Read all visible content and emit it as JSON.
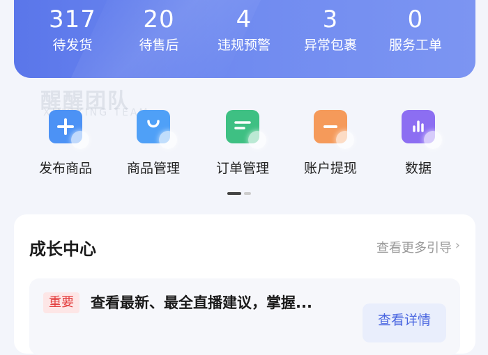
{
  "stats": [
    {
      "value": "317",
      "label": "待发货"
    },
    {
      "value": "20",
      "label": "待售后"
    },
    {
      "value": "4",
      "label": "违规预警"
    },
    {
      "value": "3",
      "label": "异常包裹"
    },
    {
      "value": "0",
      "label": "服务工单"
    }
  ],
  "watermark": {
    "title": "醒醒团队",
    "subtitle": "XINGXING TEAM"
  },
  "tools": [
    {
      "label": "发布商品",
      "icon": "plus-icon",
      "color": "#4c92f5"
    },
    {
      "label": "商品管理",
      "icon": "shopping-bag-icon",
      "color": "#4fa0f7"
    },
    {
      "label": "订单管理",
      "icon": "order-list-icon",
      "color": "#3ec083"
    },
    {
      "label": "账户提现",
      "icon": "wallet-icon",
      "color": "#f59a5a"
    },
    {
      "label": "数据",
      "icon": "bar-chart-icon",
      "color": "#8c6ef2"
    }
  ],
  "growth": {
    "title": "成长中心",
    "more_link": "查看更多引导",
    "notice": {
      "badge": "重要",
      "text": "查看最新、最全直播建议，掌握...",
      "button": "查看详情"
    }
  },
  "colors": {
    "banner": "#6a84ee",
    "badge_red": "#e33e3e",
    "link_blue": "#4a66e0"
  }
}
